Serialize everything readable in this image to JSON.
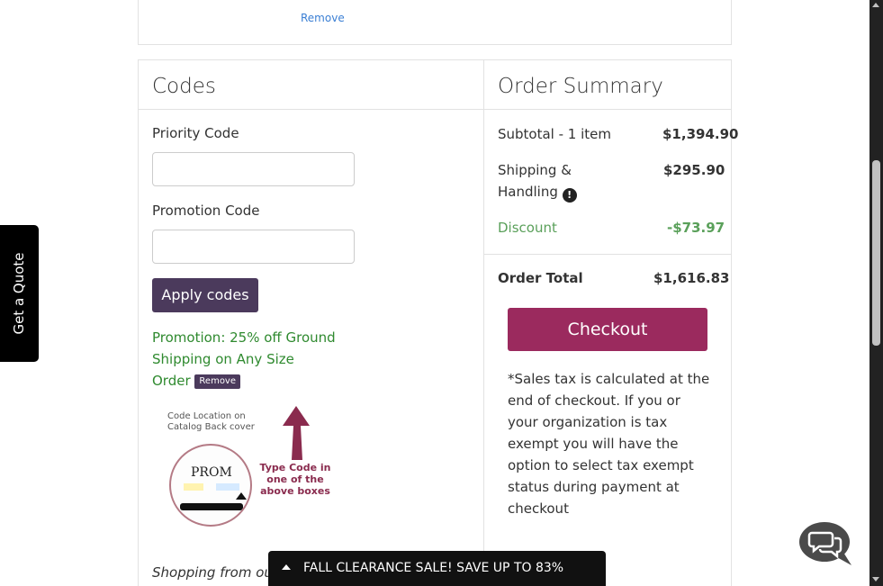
{
  "cart_item": {
    "remove_label": "Remove"
  },
  "codes": {
    "heading": "Codes",
    "priority_label": "Priority Code",
    "priority_value": "",
    "promotion_label": "Promotion Code",
    "promotion_value": "",
    "apply_label": "Apply codes",
    "promo_message": "Promotion: 25% off Ground Shipping on Any Size Order",
    "promo_remove_label": "Remove",
    "graphic": {
      "caption": "Code Location on Catalog Back cover",
      "logo_text": "PROM",
      "callout": "Type Code in one of the above boxes"
    },
    "shopping_text": "Shopping from ou"
  },
  "summary": {
    "heading": "Order Summary",
    "subtotal_label": "Subtotal - 1 item",
    "subtotal_value": "$1,394.90",
    "shipping_label": "Shipping &",
    "shipping_label_2": "Handling",
    "shipping_value": "$295.90",
    "discount_label": "Discount",
    "discount_value": "-$73.97",
    "total_label": "Order Total",
    "total_value": "$1,616.83",
    "checkout_label": "Checkout",
    "tax_note": "*Sales tax is calculated at the end of checkout. If you or your organization is tax exempt you will have the option to select tax exempt status during payment at checkout"
  },
  "side_tab": {
    "label": "Get a Quote"
  },
  "banner": {
    "text": "FALL CLEARANCE SALE! SAVE UP TO 83%"
  },
  "icons": {
    "info": "info-icon",
    "chat": "chat-bubbles-icon",
    "caret": "caret-up-icon"
  },
  "colors": {
    "apply_button": "#4b3a5c",
    "checkout_button": "#9b2a5e",
    "promo_text": "#2f8a2f",
    "discount_text": "#5aa05a",
    "link": "#3b7fd4"
  }
}
